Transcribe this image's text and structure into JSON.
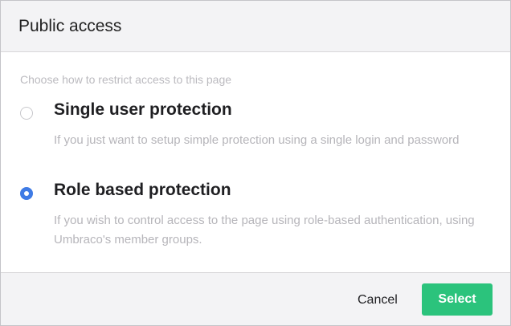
{
  "dialog": {
    "title": "Public access"
  },
  "body": {
    "hint": "Choose how to restrict access to this page",
    "options": [
      {
        "title": "Single user protection",
        "description": "If you just want to setup simple protection using a single login and password",
        "selected": false
      },
      {
        "title": "Role based protection",
        "description": "If you wish to control access to the page using role-based authentication, using Umbraco's member groups.",
        "selected": true
      }
    ]
  },
  "footer": {
    "cancel_label": "Cancel",
    "select_label": "Select"
  },
  "colors": {
    "accent_radio": "#3f7be5",
    "primary_button": "#2bc37c"
  }
}
